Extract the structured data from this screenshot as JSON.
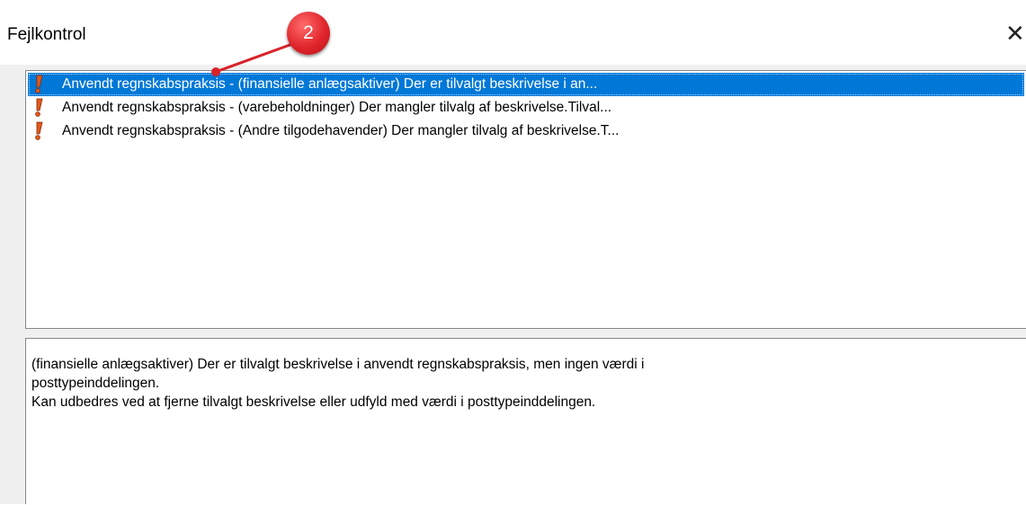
{
  "window": {
    "title": "Fejlkontrol",
    "close_icon": "close-icon"
  },
  "error_list": {
    "items": [
      {
        "text": "Anvendt regnskabspraksis - (finansielle anlægsaktiver) Der er tilvalgt beskrivelse i an...",
        "icon": "exclamation-icon",
        "selected": true
      },
      {
        "text": "Anvendt regnskabspraksis - (varebeholdninger) Der mangler tilvalg af beskrivelse.Tilval...",
        "icon": "exclamation-icon",
        "selected": false
      },
      {
        "text": "Anvendt regnskabspraksis - (Andre tilgodehavender) Der mangler tilvalg af beskrivelse.T...",
        "icon": "exclamation-icon",
        "selected": false
      }
    ]
  },
  "detail": {
    "line1": "(finansielle anlægsaktiver) Der er tilvalgt beskrivelse i anvendt regnskabspraksis, men ingen værdi i",
    "line2": "posttypeinddelingen.",
    "line3": "Kan udbedres ved at fjerne tilvalgt beskrivelse eller udfyld med værdi i posttypeinddelingen."
  },
  "callout": {
    "number": "2",
    "color": "#e0262c"
  },
  "colors": {
    "selection": "#0078d7",
    "border": "#828790",
    "dialog_bg": "#f0f0f0"
  }
}
